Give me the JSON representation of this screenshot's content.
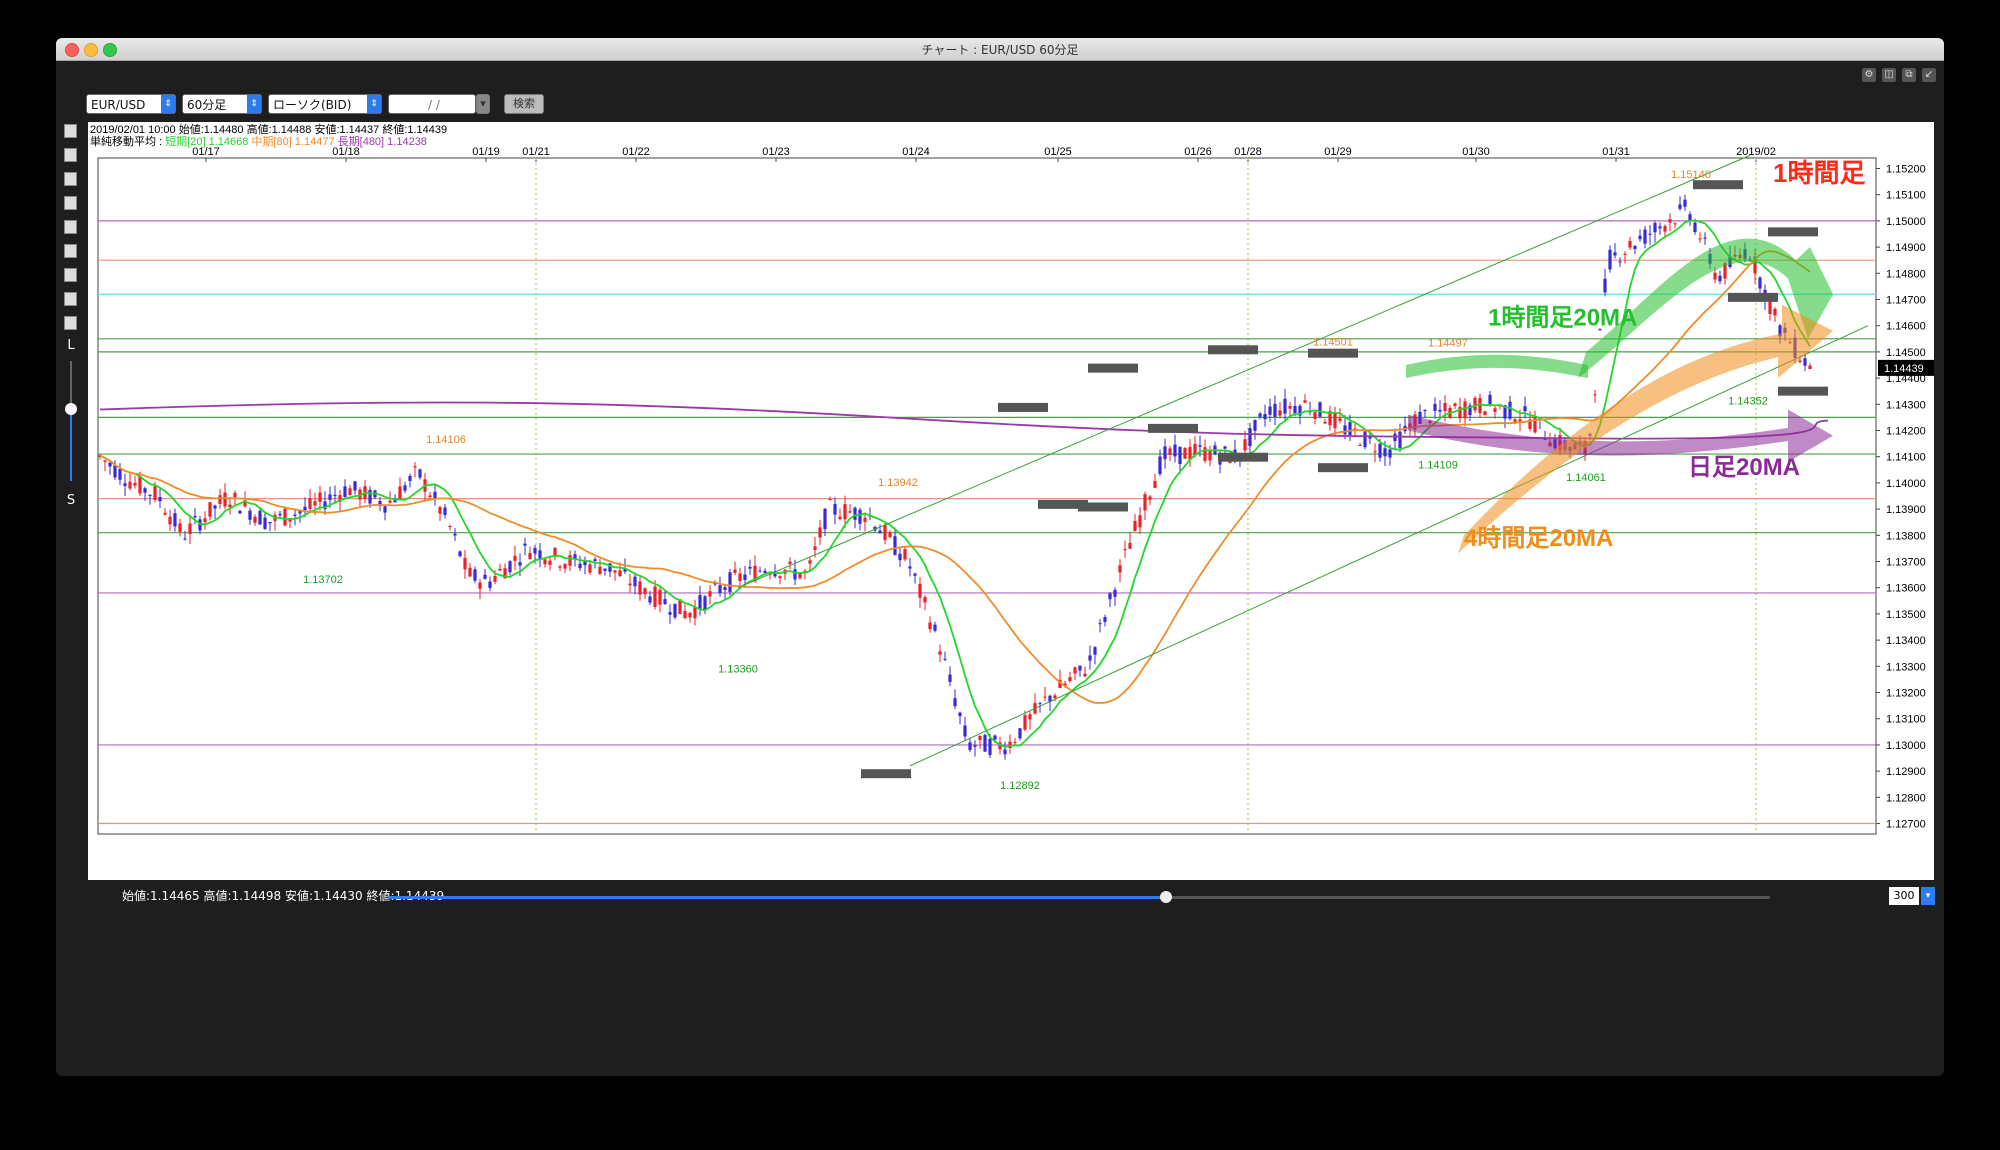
{
  "window": {
    "title": "チャート : EUR/USD 60分足"
  },
  "toolbar": {
    "symbol": "EUR/USD",
    "timeframe": "60分足",
    "chart_type": "ローソク(BID)",
    "date_placeholder": "/ /",
    "search_label": "検索"
  },
  "info": {
    "ohlc_line": "2019/02/01 10:00 始値:1.14480 高値:1.14488 安値:1.14437 終値:1.14439",
    "ma_label": "単純移動平均 :",
    "ma_short": "短期[20] 1.14668",
    "ma_mid": "中期[80] 1.14477",
    "ma_long": "長期[480] 1.14238"
  },
  "bottom": {
    "stats": "始値:1.14465 高値:1.14498 安値:1.14430 終値:1.14439",
    "zoom": "300",
    "slider_position": 0.563
  },
  "left_tools": [
    "cursor-icon",
    "trendline-icon",
    "channel-icon",
    "fibonacci-icon",
    "grid-icon",
    "text-icon",
    "rectangle-icon",
    "camera-icon",
    "save-icon"
  ],
  "left_tool_labels": {
    "l": "L",
    "s": "S"
  },
  "colors": {
    "candle_up": "#e8222a",
    "candle_down": "#3a2ad4",
    "ma_short": "#22d62a",
    "ma_mid": "#f08c2a",
    "ma_long": "#9a3aa6",
    "annot_red": "#ff2a1a",
    "annot_green": "#22c02a",
    "annot_orange": "#f08c1a",
    "annot_purple": "#8a2a96"
  },
  "chart_data": {
    "type": "candlestick",
    "instrument": "EUR/USD",
    "timeframe": "60分足",
    "x_ticks": [
      "01/17",
      "01/18",
      "01/19",
      "01/21",
      "01/22",
      "01/23",
      "01/24",
      "01/25",
      "01/26",
      "01/28",
      "01/29",
      "01/30",
      "01/31",
      "2019/02"
    ],
    "y_ticks": [
      "1.15200",
      "1.15100",
      "1.15000",
      "1.14900",
      "1.14800",
      "1.14700",
      "1.14600",
      "1.14500",
      "1.14400",
      "1.14300",
      "1.14200",
      "1.14100",
      "1.14000",
      "1.13900",
      "1.13800",
      "1.13700",
      "1.13600",
      "1.13500",
      "1.13400",
      "1.13300",
      "1.13200",
      "1.13100",
      "1.13000",
      "1.12900",
      "1.12800",
      "1.12700"
    ],
    "ylim": [
      1.1266,
      1.1524
    ],
    "current_price": "1.14439",
    "key_levels": [
      {
        "price": 1.15,
        "color": "purple"
      },
      {
        "price": 1.1485,
        "color": "salmon"
      },
      {
        "price": 1.1472,
        "color": "cyan"
      },
      {
        "price": 1.1455,
        "color": "green"
      },
      {
        "price": 1.145,
        "color": "green"
      },
      {
        "price": 1.1425,
        "color": "green"
      },
      {
        "price": 1.1411,
        "color": "green"
      },
      {
        "price": 1.1394,
        "color": "salmon"
      },
      {
        "price": 1.1381,
        "color": "green"
      },
      {
        "price": 1.1358,
        "color": "purple"
      },
      {
        "price": 1.13,
        "color": "purple"
      },
      {
        "price": 1.127,
        "color": "salmon"
      }
    ],
    "price_labels": [
      {
        "text": "1.14106",
        "price": 1.14106,
        "color": "orange"
      },
      {
        "text": "1.13702",
        "price": 1.13702,
        "color": "green"
      },
      {
        "text": "1.13360",
        "price": 1.1336,
        "color": "green"
      },
      {
        "text": "1.13942",
        "price": 1.13942,
        "color": "orange"
      },
      {
        "text": "1.12892",
        "price": 1.12892,
        "color": "green"
      },
      {
        "text": "1.14501",
        "price": 1.14501,
        "color": "orange"
      },
      {
        "text": "1.14497",
        "price": 1.14497,
        "color": "orange"
      },
      {
        "text": "1.14109",
        "price": 1.14109,
        "color": "green"
      },
      {
        "text": "1.14061",
        "price": 1.14061,
        "color": "green"
      },
      {
        "text": "1.15140",
        "price": 1.1514,
        "color": "orange"
      },
      {
        "text": "1.14352",
        "price": 1.14352,
        "color": "green"
      }
    ],
    "annotations": [
      "1時間足",
      "1時間足20MA",
      "日足20MA",
      "4時間足20MA"
    ],
    "ma_series": [
      {
        "name": "短期[20]",
        "period": 20
      },
      {
        "name": "中期[80]",
        "period": 80
      },
      {
        "name": "長期[480]",
        "period": 480
      }
    ],
    "grid": false
  }
}
